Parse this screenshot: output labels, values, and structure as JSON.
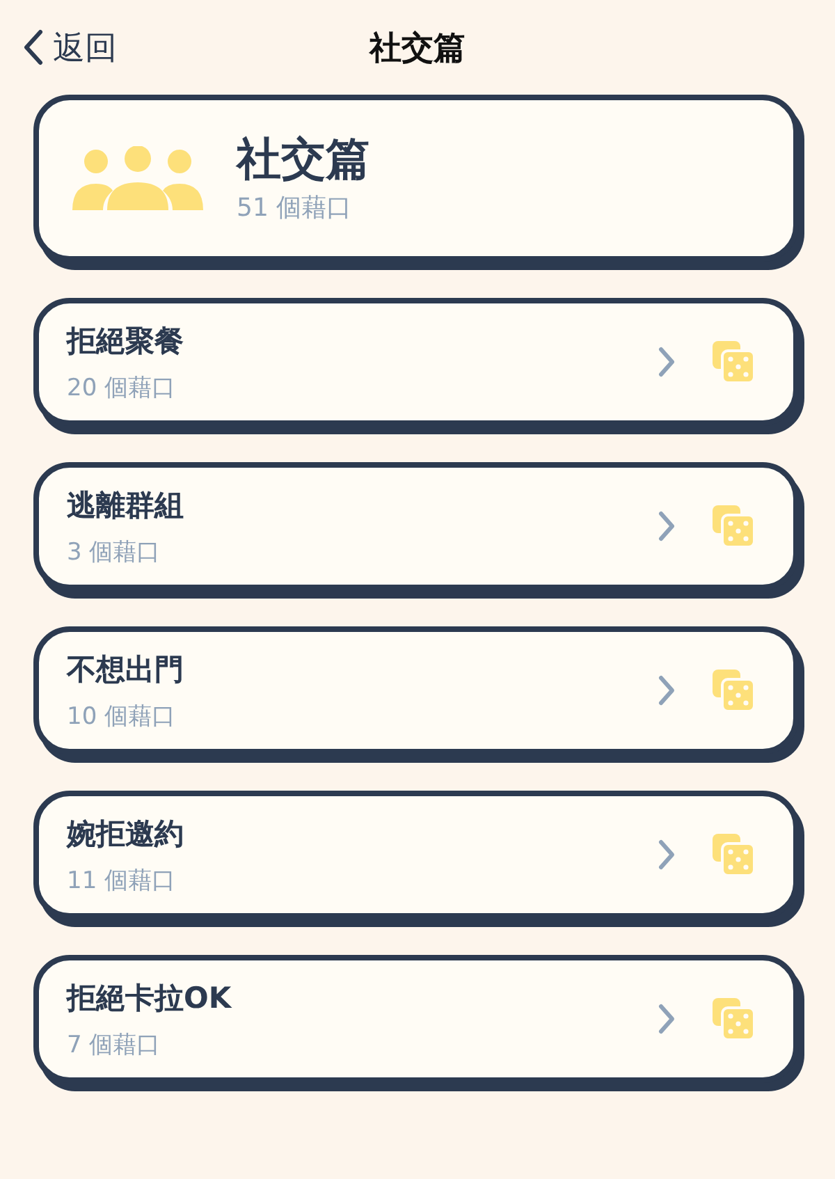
{
  "nav": {
    "back_label": "返回",
    "title": "社交篇"
  },
  "header_card": {
    "title": "社交篇",
    "count": "51 個藉口"
  },
  "categories": [
    {
      "title": "拒絕聚餐",
      "count": "20 個藉口"
    },
    {
      "title": "逃離群組",
      "count": "3 個藉口"
    },
    {
      "title": "不想出門",
      "count": "10 個藉口"
    },
    {
      "title": "婉拒邀約",
      "count": "11 個藉口"
    },
    {
      "title": "拒絕卡拉OK",
      "count": "7 個藉口"
    }
  ]
}
